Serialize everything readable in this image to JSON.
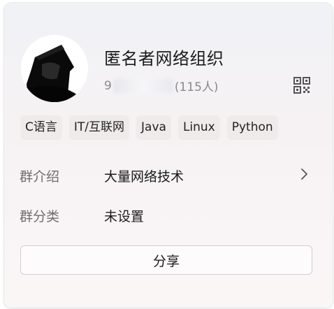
{
  "group": {
    "name": "匿名者网络组织",
    "id_prefix": "9",
    "member_count": "(115人)"
  },
  "tags": [
    "C语言",
    "IT/互联网",
    "Java",
    "Linux",
    "Python"
  ],
  "info": {
    "intro_label": "群介绍",
    "intro_value": "大量网络技术",
    "category_label": "群分类",
    "category_value": "未设置"
  },
  "share_label": "分享",
  "icons": {
    "avatar": "hooded-figure-avatar",
    "qr": "qr-code-icon",
    "intro_arrow": "chevron-right-icon"
  }
}
